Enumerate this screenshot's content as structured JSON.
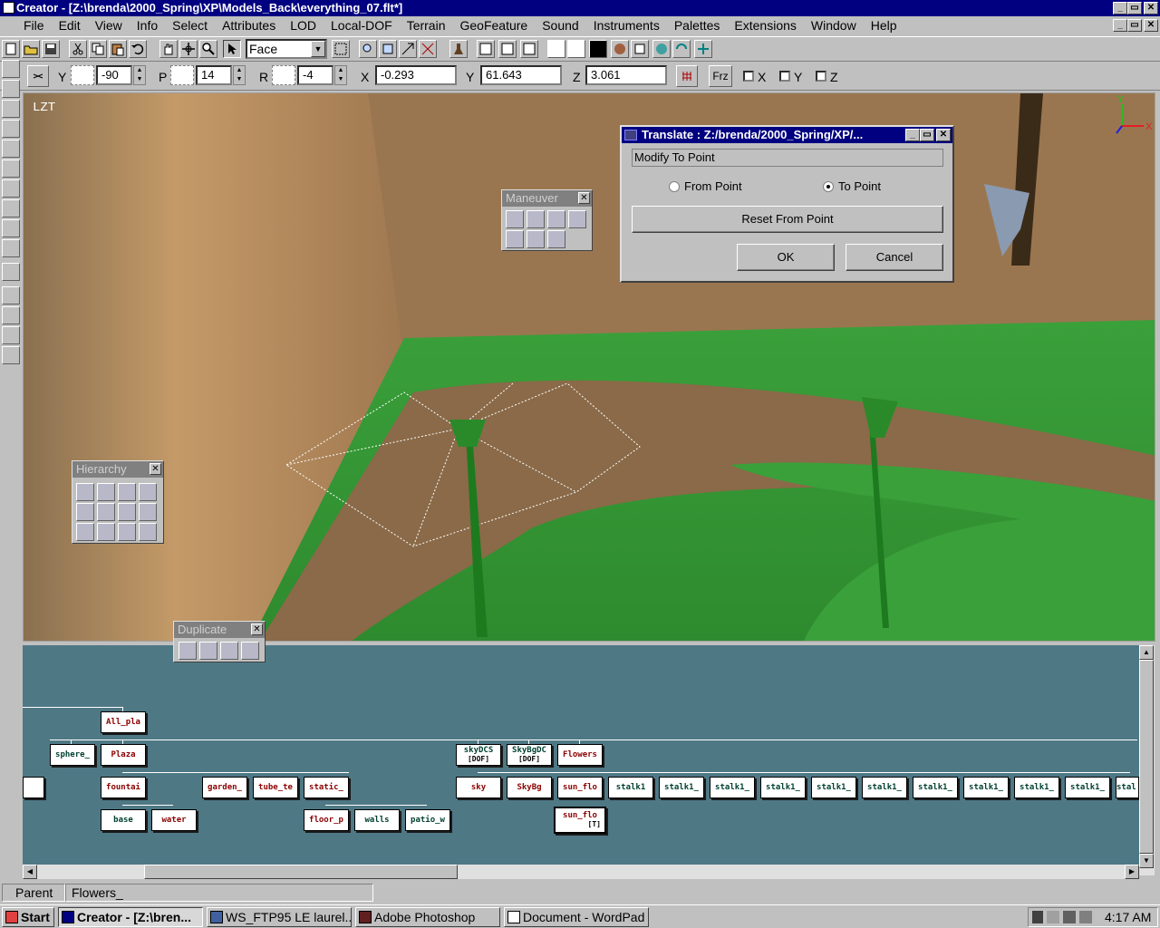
{
  "window": {
    "title": "Creator - [Z:\\brenda\\2000_Spring\\XP\\Models_Back\\everything_07.flt*]"
  },
  "menu": [
    "File",
    "Edit",
    "View",
    "Info",
    "Select",
    "Attributes",
    "LOD",
    "Local-DOF",
    "Terrain",
    "GeoFeature",
    "Sound",
    "Instruments",
    "Palettes",
    "Extensions",
    "Window",
    "Help"
  ],
  "toolbar": {
    "select_mode": "Face"
  },
  "coords": {
    "y_label": "Y",
    "y_val": "-90",
    "p_label": "P",
    "p_val": "14",
    "r_label": "R",
    "r_val": "-4",
    "x2_label": "X",
    "x2_val": "-0.293",
    "y2_label": "Y",
    "y2_val": "61.643",
    "z2_label": "Z",
    "z2_val": "3.061",
    "frz": "Frz",
    "chk_x": "X",
    "chk_y": "Y",
    "chk_z": "Z"
  },
  "viewport": {
    "label": "LZT",
    "axis_y": "Y",
    "axis_x": "X"
  },
  "palettes": {
    "maneuver": "Maneuver",
    "hierarchy": "Hierarchy",
    "duplicate": "Duplicate"
  },
  "dialog": {
    "title": "Translate : Z:/brenda/2000_Spring/XP/...",
    "mode": "Modify To Point",
    "from_point": "From Point",
    "to_point": "To Point",
    "selected": "to_point",
    "reset": "Reset From Point",
    "ok": "OK",
    "cancel": "Cancel"
  },
  "hierarchy": {
    "root": "All_pla",
    "l1": [
      "sphere_",
      "Plaza",
      "skyDCS",
      "SkyBgDC",
      "Flowers"
    ],
    "dof": "[DOF]",
    "l2a": [
      "fountai",
      "garden_",
      "tube_te",
      "static_"
    ],
    "l2b": [
      "sky",
      "SkyBg",
      "sun_flo"
    ],
    "stalks": [
      "stalk1",
      "stalk1_",
      "stalk1_",
      "stalk1_",
      "stalk1_",
      "stalk1_",
      "stalk1_",
      "stalk1_",
      "stalk1_",
      "stalk1_",
      "stal"
    ],
    "l3a": [
      "base",
      "water"
    ],
    "l3b": [
      "floor_p",
      "walls",
      "patio_w"
    ],
    "l3c": "sun_flo",
    "l3c_tag": "[T]"
  },
  "status": {
    "parent": "Parent",
    "current": "Flowers_"
  },
  "taskbar": {
    "start": "Start",
    "tasks": [
      "Creator - [Z:\\bren...",
      "WS_FTP95 LE laurel...",
      "Adobe Photoshop",
      "Document - WordPad"
    ],
    "clock": "4:17 AM"
  }
}
